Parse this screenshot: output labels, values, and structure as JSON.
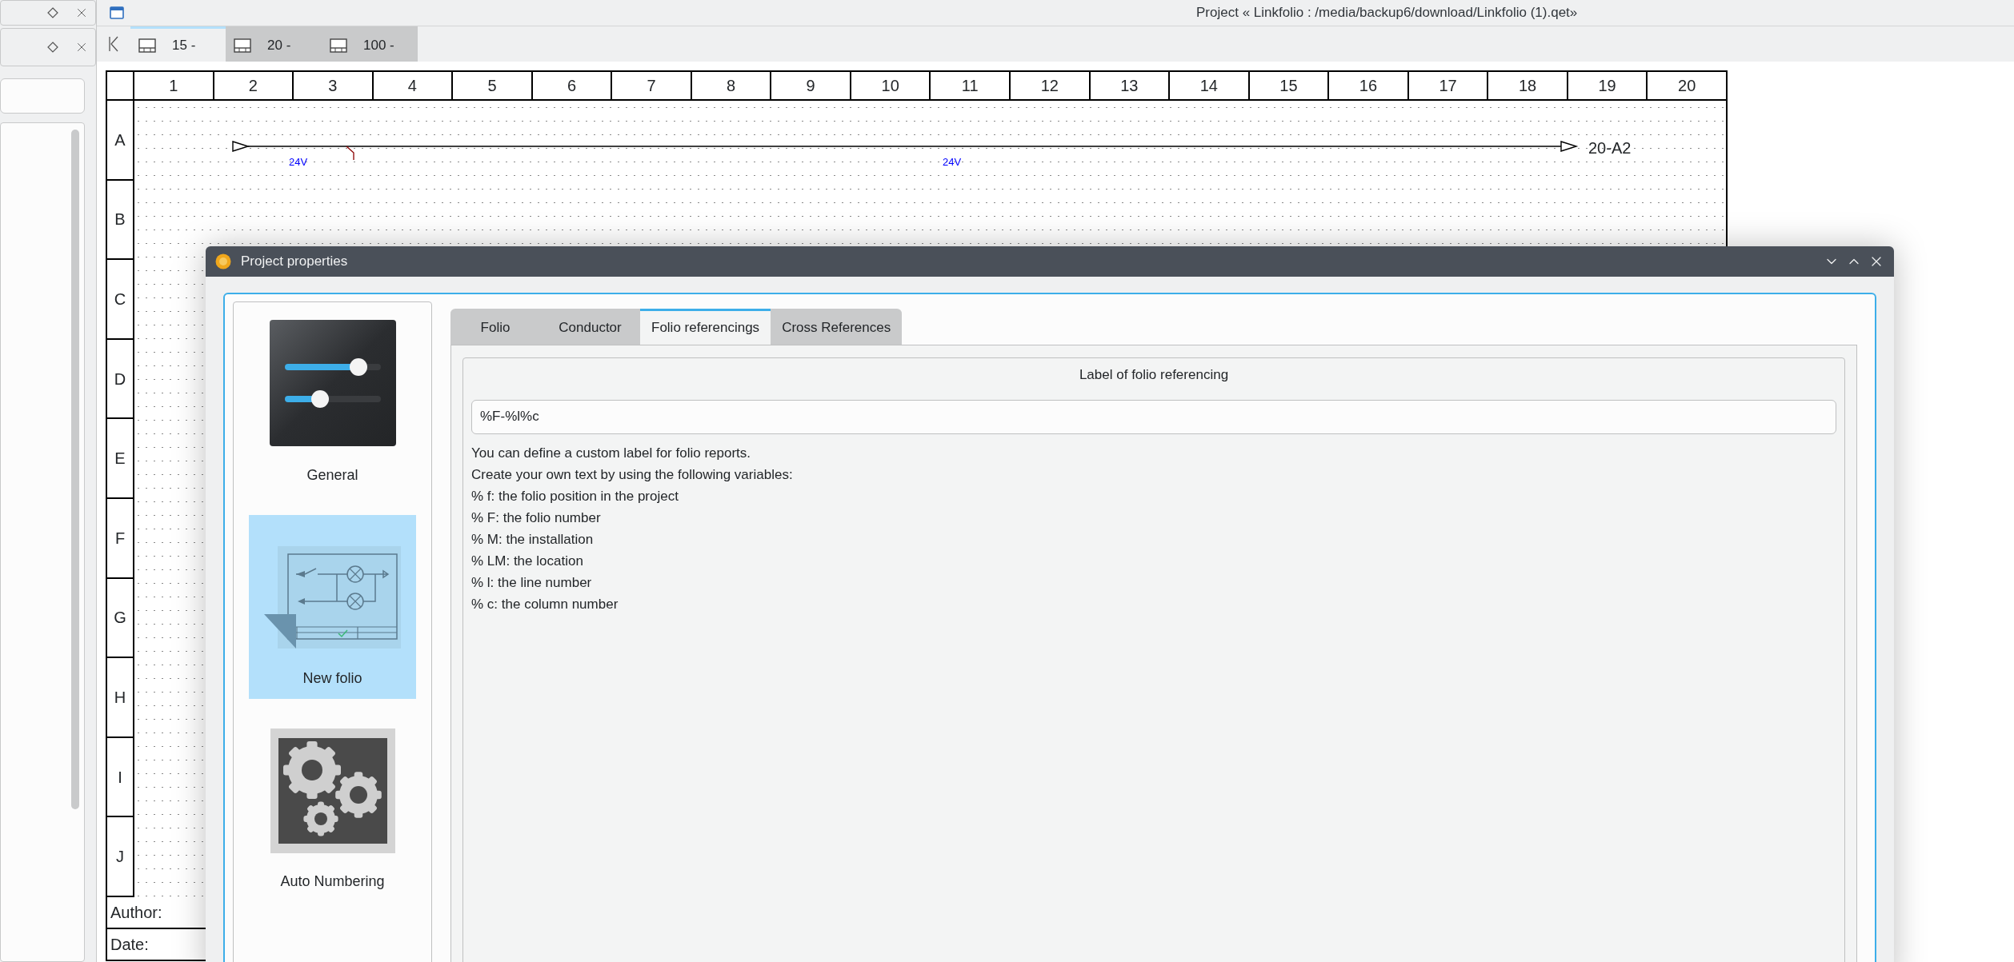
{
  "window": {
    "title": "Project « Linkfolio : /media/backup6/download/Linkfolio (1).qet»"
  },
  "folio_tabs": [
    {
      "label": "15 -",
      "selected": true
    },
    {
      "label": "20 -",
      "selected": false
    },
    {
      "label": "100 -",
      "selected": false
    }
  ],
  "folio": {
    "columns": [
      "1",
      "2",
      "3",
      "4",
      "5",
      "6",
      "7",
      "8",
      "9",
      "10",
      "11",
      "12",
      "13",
      "14",
      "15",
      "16",
      "17",
      "18",
      "19",
      "20"
    ],
    "rows": [
      "A",
      "B",
      "C",
      "D",
      "E",
      "F",
      "G",
      "H",
      "I",
      "J"
    ],
    "wire_labels": [
      "24V",
      "24V"
    ],
    "reference": "20-A2",
    "title_block": [
      "Author:",
      "Date:"
    ]
  },
  "dialog": {
    "title": "Project properties",
    "sidebar": [
      {
        "label": "General",
        "kind": "sliders",
        "selected": false
      },
      {
        "label": "New folio",
        "kind": "schematic",
        "selected": true
      },
      {
        "label": "Auto Numbering",
        "kind": "gears",
        "selected": false
      }
    ],
    "tabs": [
      {
        "label": "Folio",
        "selected": false
      },
      {
        "label": "Conductor",
        "selected": false
      },
      {
        "label": "Folio referencings",
        "selected": true
      },
      {
        "label": "Cross References",
        "selected": false
      }
    ],
    "group_title": "Label of folio referencing",
    "label_field": {
      "value": "%F-%l%c"
    },
    "help_lines": [
      "You can define a custom label for folio reports.",
      "Create your own text by using the following variables:",
      "% f: the folio position in the project",
      "% F: the folio number",
      "% M: the installation",
      "% LM: the location",
      "% l: the line number",
      "% c: the column number"
    ]
  }
}
